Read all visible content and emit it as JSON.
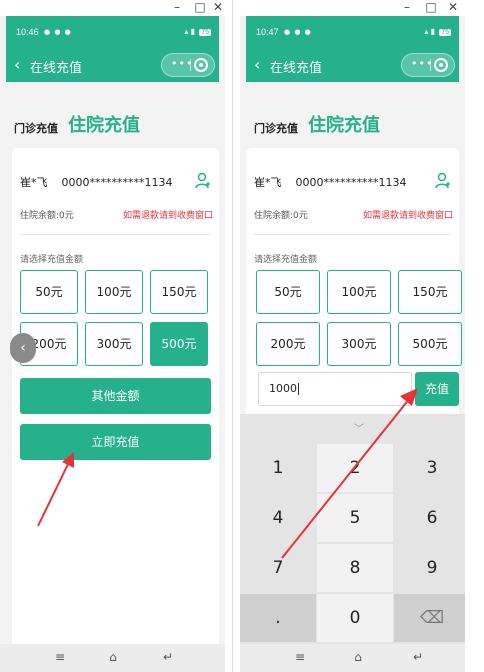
{
  "left": {
    "status": {
      "time": "10:46",
      "right_text": "75"
    },
    "nav": {
      "back_icon": "chevron-left-icon",
      "title": "在线充值",
      "more": "•••"
    },
    "tabs": {
      "outpatient": "门诊充值",
      "inpatient": "住院充值"
    },
    "patient": {
      "name": "崔*飞",
      "id": "0000**********1134"
    },
    "balance": "住院余额:0元",
    "refund_notice": "如需退款请到收费窗口",
    "prompt": "请选择充值金额",
    "amounts": [
      "50元",
      "100元",
      "150元",
      "200元",
      "300元",
      "500元"
    ],
    "selected_amount": "500元",
    "other_amount": "其他金额",
    "recharge_now": "立即充值"
  },
  "right": {
    "status": {
      "time": "10:47",
      "right_text": "75"
    },
    "nav": {
      "back_icon": "chevron-left-icon",
      "title": "在线充值",
      "more": "•••"
    },
    "tabs": {
      "outpatient": "门诊充值",
      "inpatient": "住院充值"
    },
    "patient": {
      "name": "崔*飞",
      "id": "0000**********1134"
    },
    "balance": "住院余额:0元",
    "refund_notice": "如需退款请到收费窗口",
    "prompt": "请选择充值金额",
    "amounts": [
      "50元",
      "100元",
      "150元",
      "200元",
      "300元",
      "500元"
    ],
    "input_value": "1000",
    "recharge": "充值",
    "keys": [
      "1",
      "2",
      "3",
      "4",
      "5",
      "6",
      "7",
      "8",
      "9",
      ".",
      "0",
      "⌫"
    ]
  },
  "colors": {
    "brand": "#24b18b",
    "refund": "#e5333a",
    "arrow": "#e5333a"
  }
}
